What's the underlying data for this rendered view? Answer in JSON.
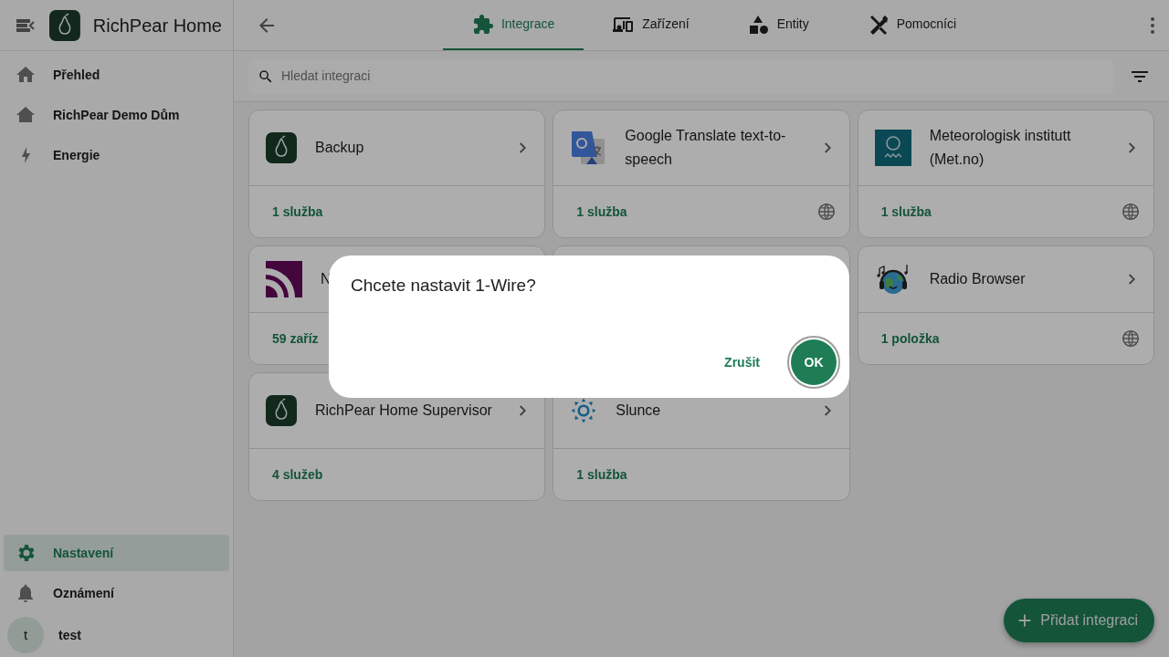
{
  "sidebar": {
    "title": "RichPear Home",
    "items": [
      {
        "label": "Přehled",
        "selected": false
      },
      {
        "label": "RichPear Demo Dům",
        "selected": false
      },
      {
        "label": "Energie",
        "selected": false
      }
    ],
    "bottom_items": [
      {
        "label": "Nastavení",
        "selected": true
      },
      {
        "label": "Oznámení",
        "selected": false
      }
    ],
    "user": {
      "initial": "t",
      "name": "test"
    }
  },
  "tabs": [
    {
      "label": "Integrace",
      "selected": true
    },
    {
      "label": "Zařízení",
      "selected": false
    },
    {
      "label": "Entity",
      "selected": false
    },
    {
      "label": "Pomocníci",
      "selected": false
    }
  ],
  "search": {
    "placeholder": "Hledat integraci"
  },
  "cards": [
    {
      "kind": "pear",
      "title": "Backup",
      "footer": "1 služba",
      "cloud": false
    },
    {
      "kind": "translate",
      "title": "Google Translate text-to-speech",
      "footer": "1 služba",
      "cloud": true
    },
    {
      "kind": "met",
      "title": "Meteorologisk institutt (Met.no)",
      "footer": "1 služba",
      "cloud": true
    },
    {
      "kind": "feed",
      "title": "N",
      "footer": "59 zaříz"
    },
    {
      "kind": "covered"
    },
    {
      "kind": "radio",
      "title": "Radio Browser",
      "footer": "1 položka",
      "cloud": true
    },
    {
      "kind": "pear",
      "title": "RichPear Home Supervisor",
      "footer": "4 služeb",
      "cloud": false
    },
    {
      "kind": "sun",
      "title": "Slunce",
      "footer": "1 služba",
      "cloud": false
    }
  ],
  "dialog": {
    "title": "Chcete nastavit 1-Wire?",
    "buttons": [
      {
        "label": "Zrušit",
        "kind": "text"
      },
      {
        "label": "OK",
        "kind": "filled",
        "focused": true
      }
    ]
  },
  "fab": {
    "label": "Přidat integraci"
  }
}
